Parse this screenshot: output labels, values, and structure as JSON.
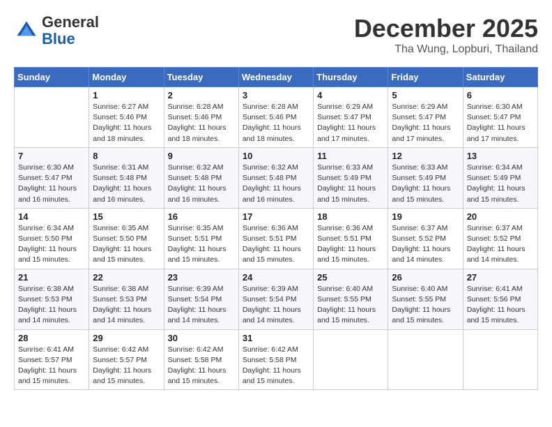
{
  "logo": {
    "line1": "General",
    "line2": "Blue"
  },
  "header": {
    "month": "December 2025",
    "location": "Tha Wung, Lopburi, Thailand"
  },
  "weekdays": [
    "Sunday",
    "Monday",
    "Tuesday",
    "Wednesday",
    "Thursday",
    "Friday",
    "Saturday"
  ],
  "weeks": [
    [
      {
        "day": "",
        "info": ""
      },
      {
        "day": "1",
        "info": "Sunrise: 6:27 AM\nSunset: 5:46 PM\nDaylight: 11 hours\nand 18 minutes."
      },
      {
        "day": "2",
        "info": "Sunrise: 6:28 AM\nSunset: 5:46 PM\nDaylight: 11 hours\nand 18 minutes."
      },
      {
        "day": "3",
        "info": "Sunrise: 6:28 AM\nSunset: 5:46 PM\nDaylight: 11 hours\nand 18 minutes."
      },
      {
        "day": "4",
        "info": "Sunrise: 6:29 AM\nSunset: 5:47 PM\nDaylight: 11 hours\nand 17 minutes."
      },
      {
        "day": "5",
        "info": "Sunrise: 6:29 AM\nSunset: 5:47 PM\nDaylight: 11 hours\nand 17 minutes."
      },
      {
        "day": "6",
        "info": "Sunrise: 6:30 AM\nSunset: 5:47 PM\nDaylight: 11 hours\nand 17 minutes."
      }
    ],
    [
      {
        "day": "7",
        "info": "Sunrise: 6:30 AM\nSunset: 5:47 PM\nDaylight: 11 hours\nand 16 minutes."
      },
      {
        "day": "8",
        "info": "Sunrise: 6:31 AM\nSunset: 5:48 PM\nDaylight: 11 hours\nand 16 minutes."
      },
      {
        "day": "9",
        "info": "Sunrise: 6:32 AM\nSunset: 5:48 PM\nDaylight: 11 hours\nand 16 minutes."
      },
      {
        "day": "10",
        "info": "Sunrise: 6:32 AM\nSunset: 5:48 PM\nDaylight: 11 hours\nand 16 minutes."
      },
      {
        "day": "11",
        "info": "Sunrise: 6:33 AM\nSunset: 5:49 PM\nDaylight: 11 hours\nand 15 minutes."
      },
      {
        "day": "12",
        "info": "Sunrise: 6:33 AM\nSunset: 5:49 PM\nDaylight: 11 hours\nand 15 minutes."
      },
      {
        "day": "13",
        "info": "Sunrise: 6:34 AM\nSunset: 5:49 PM\nDaylight: 11 hours\nand 15 minutes."
      }
    ],
    [
      {
        "day": "14",
        "info": "Sunrise: 6:34 AM\nSunset: 5:50 PM\nDaylight: 11 hours\nand 15 minutes."
      },
      {
        "day": "15",
        "info": "Sunrise: 6:35 AM\nSunset: 5:50 PM\nDaylight: 11 hours\nand 15 minutes."
      },
      {
        "day": "16",
        "info": "Sunrise: 6:35 AM\nSunset: 5:51 PM\nDaylight: 11 hours\nand 15 minutes."
      },
      {
        "day": "17",
        "info": "Sunrise: 6:36 AM\nSunset: 5:51 PM\nDaylight: 11 hours\nand 15 minutes."
      },
      {
        "day": "18",
        "info": "Sunrise: 6:36 AM\nSunset: 5:51 PM\nDaylight: 11 hours\nand 15 minutes."
      },
      {
        "day": "19",
        "info": "Sunrise: 6:37 AM\nSunset: 5:52 PM\nDaylight: 11 hours\nand 14 minutes."
      },
      {
        "day": "20",
        "info": "Sunrise: 6:37 AM\nSunset: 5:52 PM\nDaylight: 11 hours\nand 14 minutes."
      }
    ],
    [
      {
        "day": "21",
        "info": "Sunrise: 6:38 AM\nSunset: 5:53 PM\nDaylight: 11 hours\nand 14 minutes."
      },
      {
        "day": "22",
        "info": "Sunrise: 6:38 AM\nSunset: 5:53 PM\nDaylight: 11 hours\nand 14 minutes."
      },
      {
        "day": "23",
        "info": "Sunrise: 6:39 AM\nSunset: 5:54 PM\nDaylight: 11 hours\nand 14 minutes."
      },
      {
        "day": "24",
        "info": "Sunrise: 6:39 AM\nSunset: 5:54 PM\nDaylight: 11 hours\nand 14 minutes."
      },
      {
        "day": "25",
        "info": "Sunrise: 6:40 AM\nSunset: 5:55 PM\nDaylight: 11 hours\nand 15 minutes."
      },
      {
        "day": "26",
        "info": "Sunrise: 6:40 AM\nSunset: 5:55 PM\nDaylight: 11 hours\nand 15 minutes."
      },
      {
        "day": "27",
        "info": "Sunrise: 6:41 AM\nSunset: 5:56 PM\nDaylight: 11 hours\nand 15 minutes."
      }
    ],
    [
      {
        "day": "28",
        "info": "Sunrise: 6:41 AM\nSunset: 5:57 PM\nDaylight: 11 hours\nand 15 minutes."
      },
      {
        "day": "29",
        "info": "Sunrise: 6:42 AM\nSunset: 5:57 PM\nDaylight: 11 hours\nand 15 minutes."
      },
      {
        "day": "30",
        "info": "Sunrise: 6:42 AM\nSunset: 5:58 PM\nDaylight: 11 hours\nand 15 minutes."
      },
      {
        "day": "31",
        "info": "Sunrise: 6:42 AM\nSunset: 5:58 PM\nDaylight: 11 hours\nand 15 minutes."
      },
      {
        "day": "",
        "info": ""
      },
      {
        "day": "",
        "info": ""
      },
      {
        "day": "",
        "info": ""
      }
    ]
  ]
}
